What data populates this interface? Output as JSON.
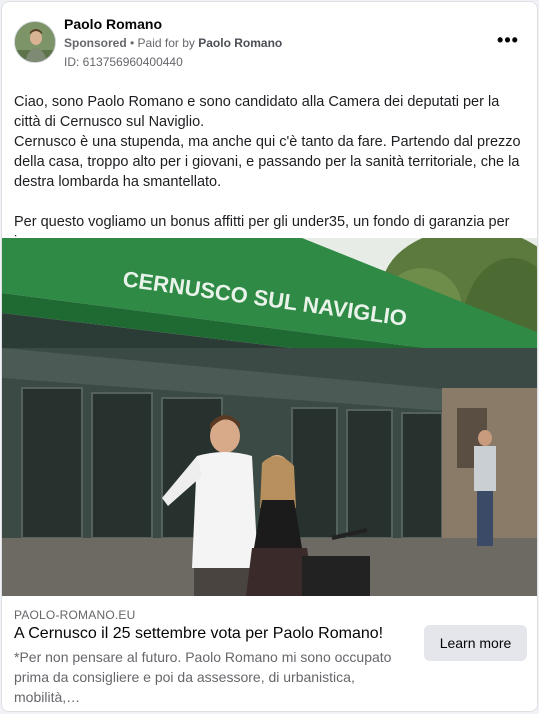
{
  "post": {
    "author_name": "Paolo Romano",
    "sponsored_label": "Sponsored",
    "separator": " • ",
    "paid_for_prefix": "Paid for by ",
    "paid_for_name": "Paolo Romano",
    "ad_id": "ID: 613756960400440",
    "more_label": "•••",
    "text": {
      "line1": "Ciao, sono Paolo Romano e sono candidato alla Camera dei deputati per la città di Cernusco sul Naviglio.",
      "line2": "Cernusco è una stupenda, ma anche qui c'è tanto da fare. Partendo dal prezzo della casa, troppo alto per i giovani, e passando per la sanità territoriale, che la destra lombarda ha smantellato.",
      "line3": "Per questo vogliamo un bonus affitti per gli under35, un fondo di garanzia per i…"
    }
  },
  "photo": {
    "station_sign": "CERNUSCO SUL NAVIGLIO"
  },
  "link_preview": {
    "domain": "PAOLO-ROMANO.EU",
    "headline": "A Cernusco il 25 settembre vota per Paolo Romano!",
    "description": "*Per non pensare al futuro. Paolo Romano mi sono occupato prima da consigliere e poi da assessore, di urbanistica, mobilità,…",
    "cta_label": "Learn more"
  }
}
